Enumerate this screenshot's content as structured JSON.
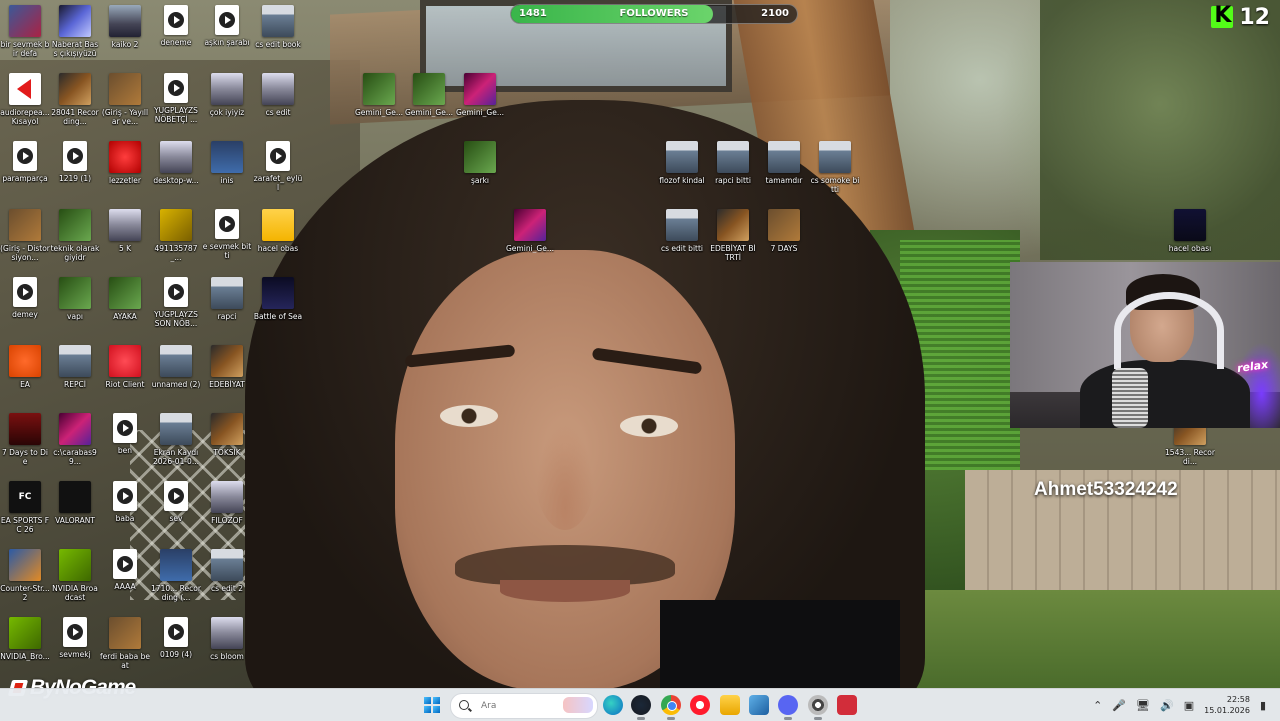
{
  "desktop_icons": [
    {
      "label": "bir sevmek bir defa",
      "kind": "k-img-a"
    },
    {
      "label": "Naberat Bass çıkışıyüzü",
      "kind": "k-img-b"
    },
    {
      "label": "kaiko 2",
      "kind": "k-img-c"
    },
    {
      "label": "deneme",
      "kind": "k-video"
    },
    {
      "label": "aşkın şarabı",
      "kind": "k-video"
    },
    {
      "label": "cs edit book",
      "kind": "k-person"
    },
    {
      "label": "audiorepea... Kısayol",
      "kind": "k-app-audio"
    },
    {
      "label": "28041 Recording...",
      "kind": "k-img-e"
    },
    {
      "label": "(Giriş - Yayıllar ve...",
      "kind": "k-img-d"
    },
    {
      "label": "YUGPLAYZS NÖBETÇİ ...",
      "kind": "k-video"
    },
    {
      "label": "çok iyiyiz",
      "kind": "k-img-h"
    },
    {
      "label": "cs edit",
      "kind": "k-img-h"
    },
    {
      "label": "Gemini_Ge...",
      "kind": "k-img-f"
    },
    {
      "label": "Gemini_Ge...",
      "kind": "k-img-f"
    },
    {
      "label": "Gemini_Ge...",
      "kind": "k-img-g"
    },
    {
      "label": "paramparça",
      "kind": "k-video"
    },
    {
      "label": "1219 (1)",
      "kind": "k-video"
    },
    {
      "label": "lezzetler",
      "kind": "k-app-red"
    },
    {
      "label": "desktop-w...",
      "kind": "k-img-h"
    },
    {
      "label": "inis",
      "kind": "k-img-i"
    },
    {
      "label": "zarafet_ eylül",
      "kind": "k-video"
    },
    {
      "label": "şarkı",
      "kind": "k-img-f"
    },
    {
      "label": "flozof kindal",
      "kind": "k-person"
    },
    {
      "label": "rapci bitti",
      "kind": "k-person"
    },
    {
      "label": "tamamdır",
      "kind": "k-person"
    },
    {
      "label": "cs somoke bitti",
      "kind": "k-person"
    },
    {
      "label": "(Giriş - Distorsiyon...",
      "kind": "k-img-d"
    },
    {
      "label": "teknik olarak giyidr",
      "kind": "k-img-f"
    },
    {
      "label": "5 K",
      "kind": "k-img-h"
    },
    {
      "label": "491135787_...",
      "kind": "k-img-j"
    },
    {
      "label": "e sevmek bitti",
      "kind": "k-video"
    },
    {
      "label": "hacel obas",
      "kind": "k-folder"
    },
    {
      "label": "Gemini_Ge...",
      "kind": "k-img-g"
    },
    {
      "label": "cs edit bitti",
      "kind": "k-person"
    },
    {
      "label": "EDEBİYAT BİTRTİ",
      "kind": "k-img-e"
    },
    {
      "label": "7 DAYS",
      "kind": "k-img-d"
    },
    {
      "label": "hacel obası",
      "kind": "k-img-k"
    },
    {
      "label": "demey",
      "kind": "k-video"
    },
    {
      "label": "vapı",
      "kind": "k-img-f"
    },
    {
      "label": "AYAKA",
      "kind": "k-img-f"
    },
    {
      "label": "YUGPLAYZS SON NÖB...",
      "kind": "k-video"
    },
    {
      "label": "rapci",
      "kind": "k-person"
    },
    {
      "label": "Battle of Sea",
      "kind": "k-app-bos"
    },
    {
      "label": "EA",
      "kind": "k-app-ea"
    },
    {
      "label": "REPCİ",
      "kind": "k-person"
    },
    {
      "label": "Riot Client",
      "kind": "k-app-riot"
    },
    {
      "label": "unnamed (2)",
      "kind": "k-person"
    },
    {
      "label": "EDEBİYAT",
      "kind": "k-img-e"
    },
    {
      "label": "7 Days to Die",
      "kind": "k-app-7d"
    },
    {
      "label": "c:\\carabas99...",
      "kind": "k-img-g"
    },
    {
      "label": "ben",
      "kind": "k-video"
    },
    {
      "label": "Ekran Kaydı 2026-01-0...",
      "kind": "k-person"
    },
    {
      "label": "TOKSİK",
      "kind": "k-img-e"
    },
    {
      "label": "1543... Recordi...",
      "kind": "k-img-e"
    },
    {
      "label": "EA SPORTS FC 26",
      "kind": "k-app-fc"
    },
    {
      "label": "VALORANT",
      "kind": "k-app-val"
    },
    {
      "label": "baba",
      "kind": "k-video"
    },
    {
      "label": "sev",
      "kind": "k-video"
    },
    {
      "label": "FILOZOF",
      "kind": "k-img-h"
    },
    {
      "label": "Counter-Str... 2",
      "kind": "k-app-cs"
    },
    {
      "label": "NVIDIA Broadcast",
      "kind": "k-app-nv"
    },
    {
      "label": "AAAA",
      "kind": "k-video"
    },
    {
      "label": "1710... Recording (...",
      "kind": "k-img-i"
    },
    {
      "label": "cs edit 2",
      "kind": "k-person"
    },
    {
      "label": "NVIDIA_Bro...",
      "kind": "k-app-nv"
    },
    {
      "label": "sevmekj",
      "kind": "k-video"
    },
    {
      "label": "ferdi baba beat",
      "kind": "k-img-d"
    },
    {
      "label": "0109 (4)",
      "kind": "k-video"
    },
    {
      "label": "cs bloom",
      "kind": "k-img-h"
    }
  ],
  "overlay": {
    "followers": {
      "current": "1481",
      "label": "FOLLOWERS",
      "goal": "2100",
      "progress": 0.705
    },
    "kick_viewers": "12",
    "streamer_name": "Ahmet53324242",
    "sponsor": "ByNoGame",
    "webcam_neon": "relax"
  },
  "taskbar": {
    "search_placeholder": "Ara",
    "time": "22:58",
    "date": "15.01.2026"
  }
}
